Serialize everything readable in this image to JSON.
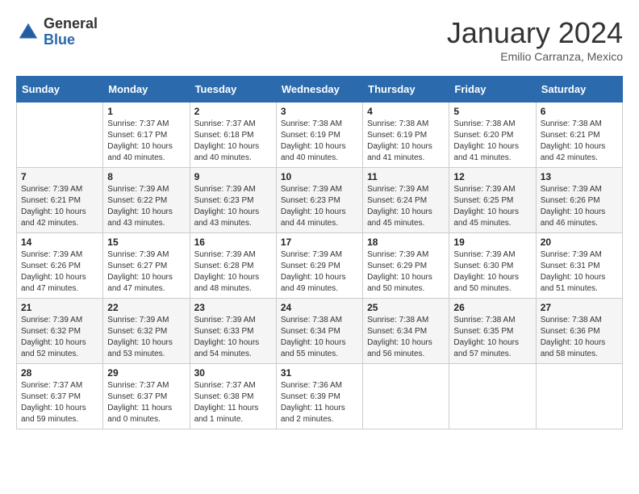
{
  "header": {
    "logo_general": "General",
    "logo_blue": "Blue",
    "title": "January 2024",
    "subtitle": "Emilio Carranza, Mexico"
  },
  "weekdays": [
    "Sunday",
    "Monday",
    "Tuesday",
    "Wednesday",
    "Thursday",
    "Friday",
    "Saturday"
  ],
  "weeks": [
    [
      {
        "day": "",
        "info": ""
      },
      {
        "day": "1",
        "info": "Sunrise: 7:37 AM\nSunset: 6:17 PM\nDaylight: 10 hours\nand 40 minutes."
      },
      {
        "day": "2",
        "info": "Sunrise: 7:37 AM\nSunset: 6:18 PM\nDaylight: 10 hours\nand 40 minutes."
      },
      {
        "day": "3",
        "info": "Sunrise: 7:38 AM\nSunset: 6:19 PM\nDaylight: 10 hours\nand 40 minutes."
      },
      {
        "day": "4",
        "info": "Sunrise: 7:38 AM\nSunset: 6:19 PM\nDaylight: 10 hours\nand 41 minutes."
      },
      {
        "day": "5",
        "info": "Sunrise: 7:38 AM\nSunset: 6:20 PM\nDaylight: 10 hours\nand 41 minutes."
      },
      {
        "day": "6",
        "info": "Sunrise: 7:38 AM\nSunset: 6:21 PM\nDaylight: 10 hours\nand 42 minutes."
      }
    ],
    [
      {
        "day": "7",
        "info": "Sunrise: 7:39 AM\nSunset: 6:21 PM\nDaylight: 10 hours\nand 42 minutes."
      },
      {
        "day": "8",
        "info": "Sunrise: 7:39 AM\nSunset: 6:22 PM\nDaylight: 10 hours\nand 43 minutes."
      },
      {
        "day": "9",
        "info": "Sunrise: 7:39 AM\nSunset: 6:23 PM\nDaylight: 10 hours\nand 43 minutes."
      },
      {
        "day": "10",
        "info": "Sunrise: 7:39 AM\nSunset: 6:23 PM\nDaylight: 10 hours\nand 44 minutes."
      },
      {
        "day": "11",
        "info": "Sunrise: 7:39 AM\nSunset: 6:24 PM\nDaylight: 10 hours\nand 45 minutes."
      },
      {
        "day": "12",
        "info": "Sunrise: 7:39 AM\nSunset: 6:25 PM\nDaylight: 10 hours\nand 45 minutes."
      },
      {
        "day": "13",
        "info": "Sunrise: 7:39 AM\nSunset: 6:26 PM\nDaylight: 10 hours\nand 46 minutes."
      }
    ],
    [
      {
        "day": "14",
        "info": "Sunrise: 7:39 AM\nSunset: 6:26 PM\nDaylight: 10 hours\nand 47 minutes."
      },
      {
        "day": "15",
        "info": "Sunrise: 7:39 AM\nSunset: 6:27 PM\nDaylight: 10 hours\nand 47 minutes."
      },
      {
        "day": "16",
        "info": "Sunrise: 7:39 AM\nSunset: 6:28 PM\nDaylight: 10 hours\nand 48 minutes."
      },
      {
        "day": "17",
        "info": "Sunrise: 7:39 AM\nSunset: 6:29 PM\nDaylight: 10 hours\nand 49 minutes."
      },
      {
        "day": "18",
        "info": "Sunrise: 7:39 AM\nSunset: 6:29 PM\nDaylight: 10 hours\nand 50 minutes."
      },
      {
        "day": "19",
        "info": "Sunrise: 7:39 AM\nSunset: 6:30 PM\nDaylight: 10 hours\nand 50 minutes."
      },
      {
        "day": "20",
        "info": "Sunrise: 7:39 AM\nSunset: 6:31 PM\nDaylight: 10 hours\nand 51 minutes."
      }
    ],
    [
      {
        "day": "21",
        "info": "Sunrise: 7:39 AM\nSunset: 6:32 PM\nDaylight: 10 hours\nand 52 minutes."
      },
      {
        "day": "22",
        "info": "Sunrise: 7:39 AM\nSunset: 6:32 PM\nDaylight: 10 hours\nand 53 minutes."
      },
      {
        "day": "23",
        "info": "Sunrise: 7:39 AM\nSunset: 6:33 PM\nDaylight: 10 hours\nand 54 minutes."
      },
      {
        "day": "24",
        "info": "Sunrise: 7:38 AM\nSunset: 6:34 PM\nDaylight: 10 hours\nand 55 minutes."
      },
      {
        "day": "25",
        "info": "Sunrise: 7:38 AM\nSunset: 6:34 PM\nDaylight: 10 hours\nand 56 minutes."
      },
      {
        "day": "26",
        "info": "Sunrise: 7:38 AM\nSunset: 6:35 PM\nDaylight: 10 hours\nand 57 minutes."
      },
      {
        "day": "27",
        "info": "Sunrise: 7:38 AM\nSunset: 6:36 PM\nDaylight: 10 hours\nand 58 minutes."
      }
    ],
    [
      {
        "day": "28",
        "info": "Sunrise: 7:37 AM\nSunset: 6:37 PM\nDaylight: 10 hours\nand 59 minutes."
      },
      {
        "day": "29",
        "info": "Sunrise: 7:37 AM\nSunset: 6:37 PM\nDaylight: 11 hours\nand 0 minutes."
      },
      {
        "day": "30",
        "info": "Sunrise: 7:37 AM\nSunset: 6:38 PM\nDaylight: 11 hours\nand 1 minute."
      },
      {
        "day": "31",
        "info": "Sunrise: 7:36 AM\nSunset: 6:39 PM\nDaylight: 11 hours\nand 2 minutes."
      },
      {
        "day": "",
        "info": ""
      },
      {
        "day": "",
        "info": ""
      },
      {
        "day": "",
        "info": ""
      }
    ]
  ]
}
